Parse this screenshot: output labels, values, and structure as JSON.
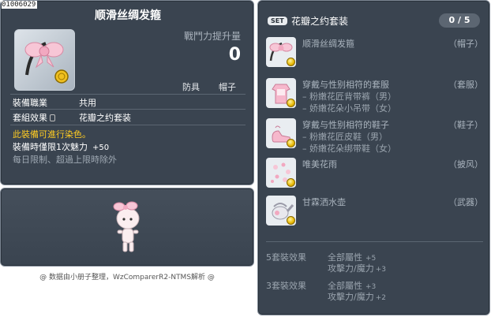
{
  "item_id": "01006029",
  "item": {
    "name": "顺滑丝绸发箍",
    "cp_label": "戰鬥力提升量",
    "cp_value": "0",
    "tags": [
      "防具",
      "帽子"
    ],
    "job_label": "裝備職業",
    "job_value": "共用",
    "set_label": "套組效果",
    "set_value": "花瓣之约套装",
    "dye_note": "此裝備可進行染色。",
    "charm_label": "裝備時僅限1次魅力",
    "charm_value": "+50",
    "limit_note": "每日限制、超過上限時除外"
  },
  "credit": "@ 数据由小册子整理，WzComparerR2-NTMS解析 @",
  "set": {
    "badge": "SET",
    "name": "花瓣之约套装",
    "count": "0 / 5",
    "items": [
      {
        "name": "顺滑丝绸发箍",
        "type": "（帽子）",
        "subs": []
      },
      {
        "name": "穿戴与性别相符的套服",
        "type": "（套服）",
        "subs": [
          "– 粉嫩花匠背带裤（男）",
          "– 娇嫩花朵小吊带（女）"
        ]
      },
      {
        "name": "穿戴与性别相符的鞋子",
        "type": "（鞋子）",
        "subs": [
          "– 粉嫩花匠皮鞋（男）",
          "– 娇嫩花朵绑带鞋（女）"
        ]
      },
      {
        "name": "唯美花雨",
        "type": "（披风）",
        "subs": []
      },
      {
        "name": "甘霖洒水壶",
        "type": "（武器）",
        "subs": []
      }
    ],
    "bonuses": [
      {
        "label": "5套裝效果",
        "lines": [
          {
            "stat": "全部屬性",
            "val": "+5"
          },
          {
            "stat": "攻擊力/魔力",
            "val": "+3"
          }
        ]
      },
      {
        "label": "3套裝效果",
        "lines": [
          {
            "stat": "全部屬性",
            "val": "+3"
          },
          {
            "stat": "攻擊力/魔力",
            "val": "+2"
          }
        ]
      }
    ]
  },
  "colors": {
    "panel_bg": "#3a4450",
    "dye_yellow": "#ffcc22",
    "muted_text": "#9aa4ae"
  },
  "icons": [
    "pink-bow-headband-icon",
    "gold-medal-icon",
    "lock-icon",
    "pink-outfit-icon",
    "pink-shoes-icon",
    "flower-rain-cape-icon",
    "watering-can-icon",
    "character-preview"
  ]
}
